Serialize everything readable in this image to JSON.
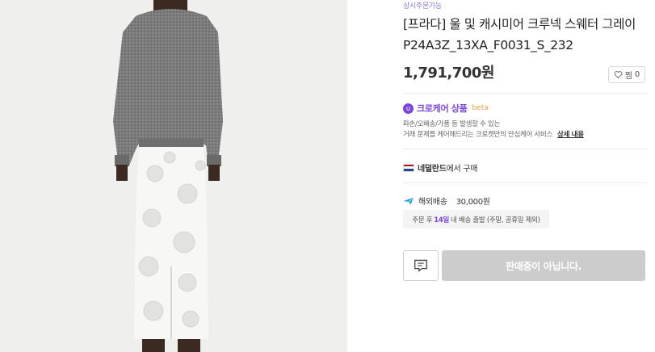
{
  "product": {
    "availability": "상시주문가능",
    "title": "[프라다] 울 및 캐시미어 크루넥 스웨터 그레이 P24A3Z_13XA_F0031_S_232",
    "price": "1,791,700원",
    "like_label": "찜",
    "like_count": "0"
  },
  "care": {
    "title": "크로케어 상품",
    "beta": "beta",
    "desc_line1": "파손/오배송/가품 등 발생할 수 있는",
    "desc_line2": "거래 문제를 케어해드리는 크로켓만의 안심케어 서비스",
    "more_label": "상세 내용"
  },
  "origin": {
    "country": "네덜란드",
    "suffix": "에서 구매",
    "flag_colors": [
      "#ae1c28",
      "#ffffff",
      "#21468b"
    ]
  },
  "shipping": {
    "label": "해외배송",
    "fee": "30,000원",
    "eta_prefix": "주문 후",
    "eta_days": "14일",
    "eta_suffix": "내 배송 출발 (주말, 공휴일 제외)"
  },
  "actions": {
    "chat_icon": "chat-icon",
    "soldout_label": "판매중이 아닙니다."
  },
  "colors": {
    "accent": "#7b45e0",
    "disabled": "#cccccc"
  }
}
